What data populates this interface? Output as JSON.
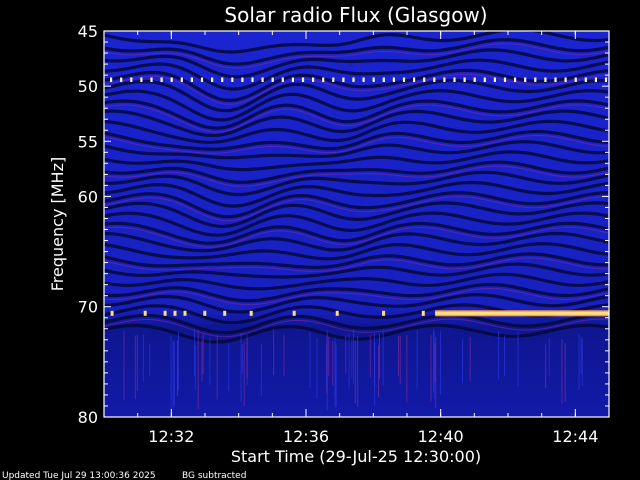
{
  "chart_data": {
    "type": "heatmap",
    "title": "Solar radio Flux (Glasgow)",
    "xlabel": "Start Time (29-Jul-25 12:30:00)",
    "ylabel": "Frequency [MHz]",
    "x_range": [
      "12:30:00",
      "12:45:00"
    ],
    "y_range_mhz": [
      45,
      80
    ],
    "y_scale": "inverted",
    "x_ticks": [
      "12:32",
      "12:36",
      "12:40",
      "12:44"
    ],
    "y_ticks": [
      45,
      50,
      55,
      60,
      70,
      80
    ],
    "emission_bands": [
      {
        "frequency_mhz": 49.4,
        "pattern": "dashed",
        "start": "12:30",
        "end": "12:45"
      },
      {
        "frequency_mhz": 70.6,
        "pattern": "sporadic",
        "start": "12:30",
        "end": "12:39:50"
      },
      {
        "frequency_mhz": 70.6,
        "pattern": "continuous",
        "start": "12:39:50",
        "end": "12:45"
      }
    ],
    "grid": false,
    "legend": "none",
    "colors": {
      "background": "#000000",
      "spectrogram_base": "#1a22c8",
      "dark_stripes": "#05083a",
      "hot_emission": "#ffe080",
      "axis": "#ffffff"
    }
  },
  "footer": {
    "updated": "Updated Tue Jul 29 13:00:36 2025",
    "note": "BG subtracted"
  }
}
